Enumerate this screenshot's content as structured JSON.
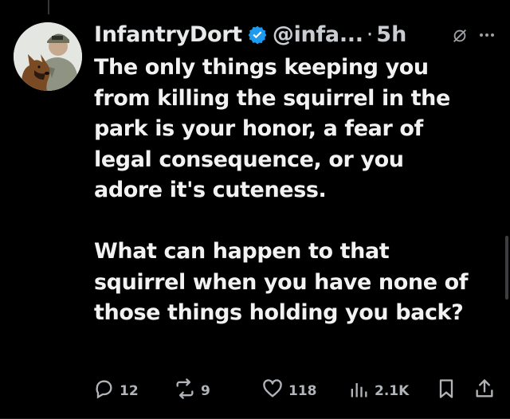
{
  "tweet": {
    "display_name": "InfantryDort",
    "handle": "@infa...",
    "separator": "·",
    "time": "5h",
    "text": "The only things keeping you\nfrom killing the squirrel in the\npark is your honor, a fear of\nlegal consequence, or you\nadore it's cuteness.\n\nWhat can happen to that\nsquirrel when you have none of\nthose things holding you back?"
  },
  "actions": {
    "replies": "12",
    "reposts": "9",
    "likes": "118",
    "views": "2.1K"
  },
  "icons": {
    "verified": "verified-badge-icon",
    "grok": "grok-icon",
    "more": "more-options-icon",
    "reply": "reply-icon",
    "repost": "repost-icon",
    "like": "heart-icon",
    "views": "views-icon",
    "bookmark": "bookmark-icon",
    "share": "share-icon"
  },
  "colors": {
    "background": "#000000",
    "text": "#e7e9ea",
    "secondary": "#b0b3b8",
    "verified": "#1d9bf0"
  }
}
